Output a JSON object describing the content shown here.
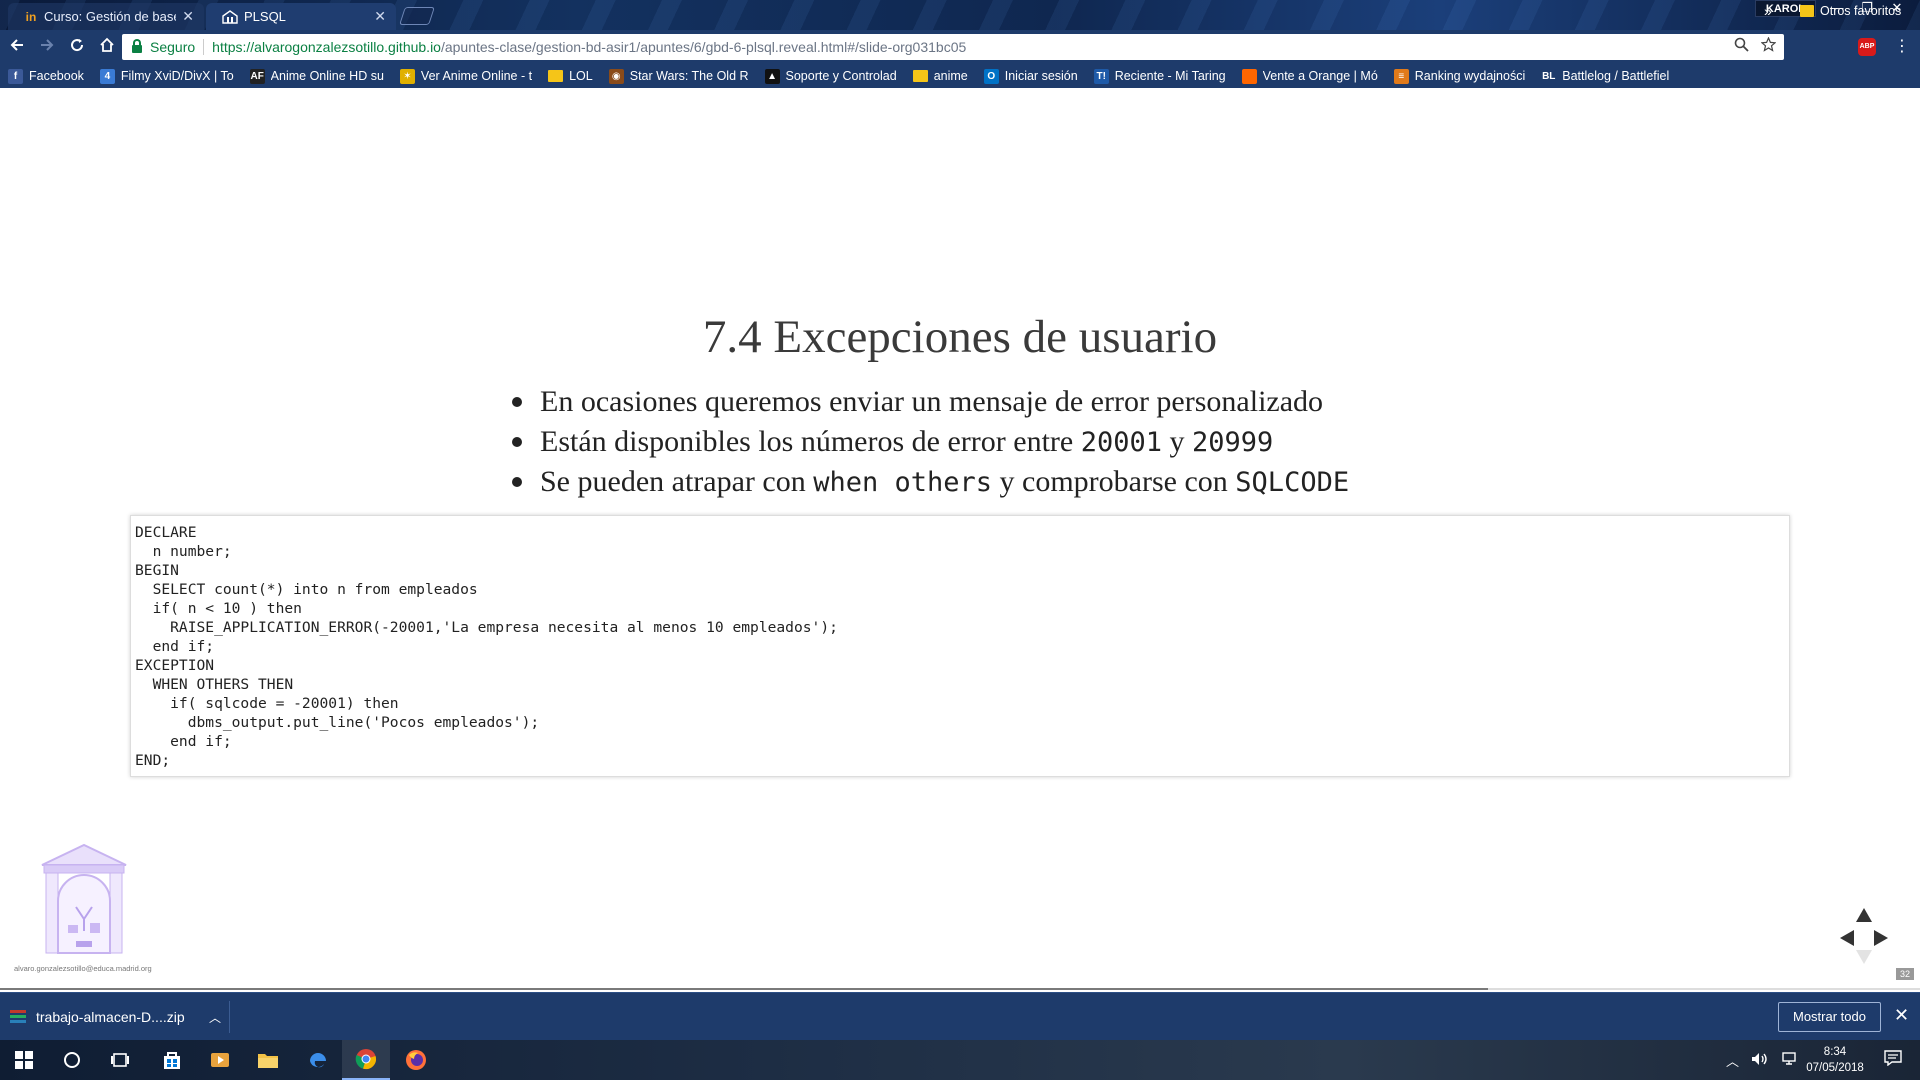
{
  "browser": {
    "tabs": [
      {
        "label": "Curso: Gestión de bases d",
        "favicon": "in-icon",
        "active": false
      },
      {
        "label": "PLSQL",
        "favicon": "page-icon",
        "active": true
      }
    ],
    "user": "KAROL",
    "window_controls": {
      "minimize": "—",
      "restore": "❐",
      "close": "✕"
    },
    "security_label": "Seguro",
    "url_host": "https://alvarogonzalezsotillo.github.io",
    "url_path": "/apuntes-clase/gestion-bd-asir1/apuntes/6/gbd-6-plsql.reveal.html#/slide-org031bc05",
    "extension_label": "ABP"
  },
  "bookmarks": {
    "items": [
      {
        "label": "Facebook",
        "icon": "facebook-icon",
        "color": "#3b5998",
        "glyph": "f"
      },
      {
        "label": "Filmy XviD/DivX | To",
        "icon": "number4-icon",
        "color": "#3a7bd5",
        "glyph": "4"
      },
      {
        "label": "Anime Online HD su",
        "icon": "af-icon",
        "color": "#222222",
        "glyph": "AF"
      },
      {
        "label": "Ver Anime Online - t",
        "icon": "star-icon",
        "color": "#e0b000",
        "glyph": "✶"
      },
      {
        "label": "LOL",
        "icon": "folder-icon",
        "color": "#f5c518",
        "glyph": ""
      },
      {
        "label": "Star Wars: The Old R",
        "icon": "swtor-icon",
        "color": "#8a4b1a",
        "glyph": "◉"
      },
      {
        "label": "Soporte y Controlad",
        "icon": "nvidia-icon",
        "color": "#111111",
        "glyph": "▲"
      },
      {
        "label": "anime",
        "icon": "folder-icon",
        "color": "#f5c518",
        "glyph": ""
      },
      {
        "label": "Iniciar sesión",
        "icon": "outlook-icon",
        "color": "#0072c6",
        "glyph": "O"
      },
      {
        "label": "Reciente - Mi Taring",
        "icon": "taringa-icon",
        "color": "#1e5aa8",
        "glyph": "T!"
      },
      {
        "label": "Vente a Orange | Mó",
        "icon": "orange-icon",
        "color": "#ff6600",
        "glyph": ""
      },
      {
        "label": "Ranking wydajności",
        "icon": "ranking-icon",
        "color": "#e07a1a",
        "glyph": "≡"
      },
      {
        "label": "Battlelog / Battlefiel",
        "icon": "battlelog-icon",
        "color": "#1e3b6b",
        "glyph": "BL"
      }
    ],
    "more": "»",
    "other_label": "Otros favoritos"
  },
  "slide": {
    "title": "7.4 Excepciones de usuario",
    "bullet1": "En ocasiones queremos enviar un mensaje de error personalizado",
    "bullet2_pre": "Están disponibles los números de error entre ",
    "bullet2_code1": "20001",
    "bullet2_mid": " y ",
    "bullet2_code2": "20999",
    "bullet3_pre": "Se pueden atrapar con ",
    "bullet3_code1": "when others",
    "bullet3_mid": " y comprobarse con ",
    "bullet3_code2": "SQLCODE",
    "code": "DECLARE\n  n number;\nBEGIN\n  SELECT count(*) into n from empleados\n  if( n < 10 ) then\n    RAISE_APPLICATION_ERROR(-20001,'La empresa necesita al menos 10 empleados');\n  end if;\nEXCEPTION\n  WHEN OTHERS THEN\n    if( sqlcode = -20001) then\n      dbms_output.put_line('Pocos empleados');\n    end if;\nEND;",
    "author_email": "alvaro.gonzalezsotillo@educa.madrid.org",
    "slide_number": "32",
    "progress_fraction": 0.775
  },
  "downloads": {
    "file": "trabajo-almacen-D....zip",
    "show_all": "Mostrar todo"
  },
  "taskbar": {
    "time": "8:34",
    "date": "07/05/2018"
  }
}
